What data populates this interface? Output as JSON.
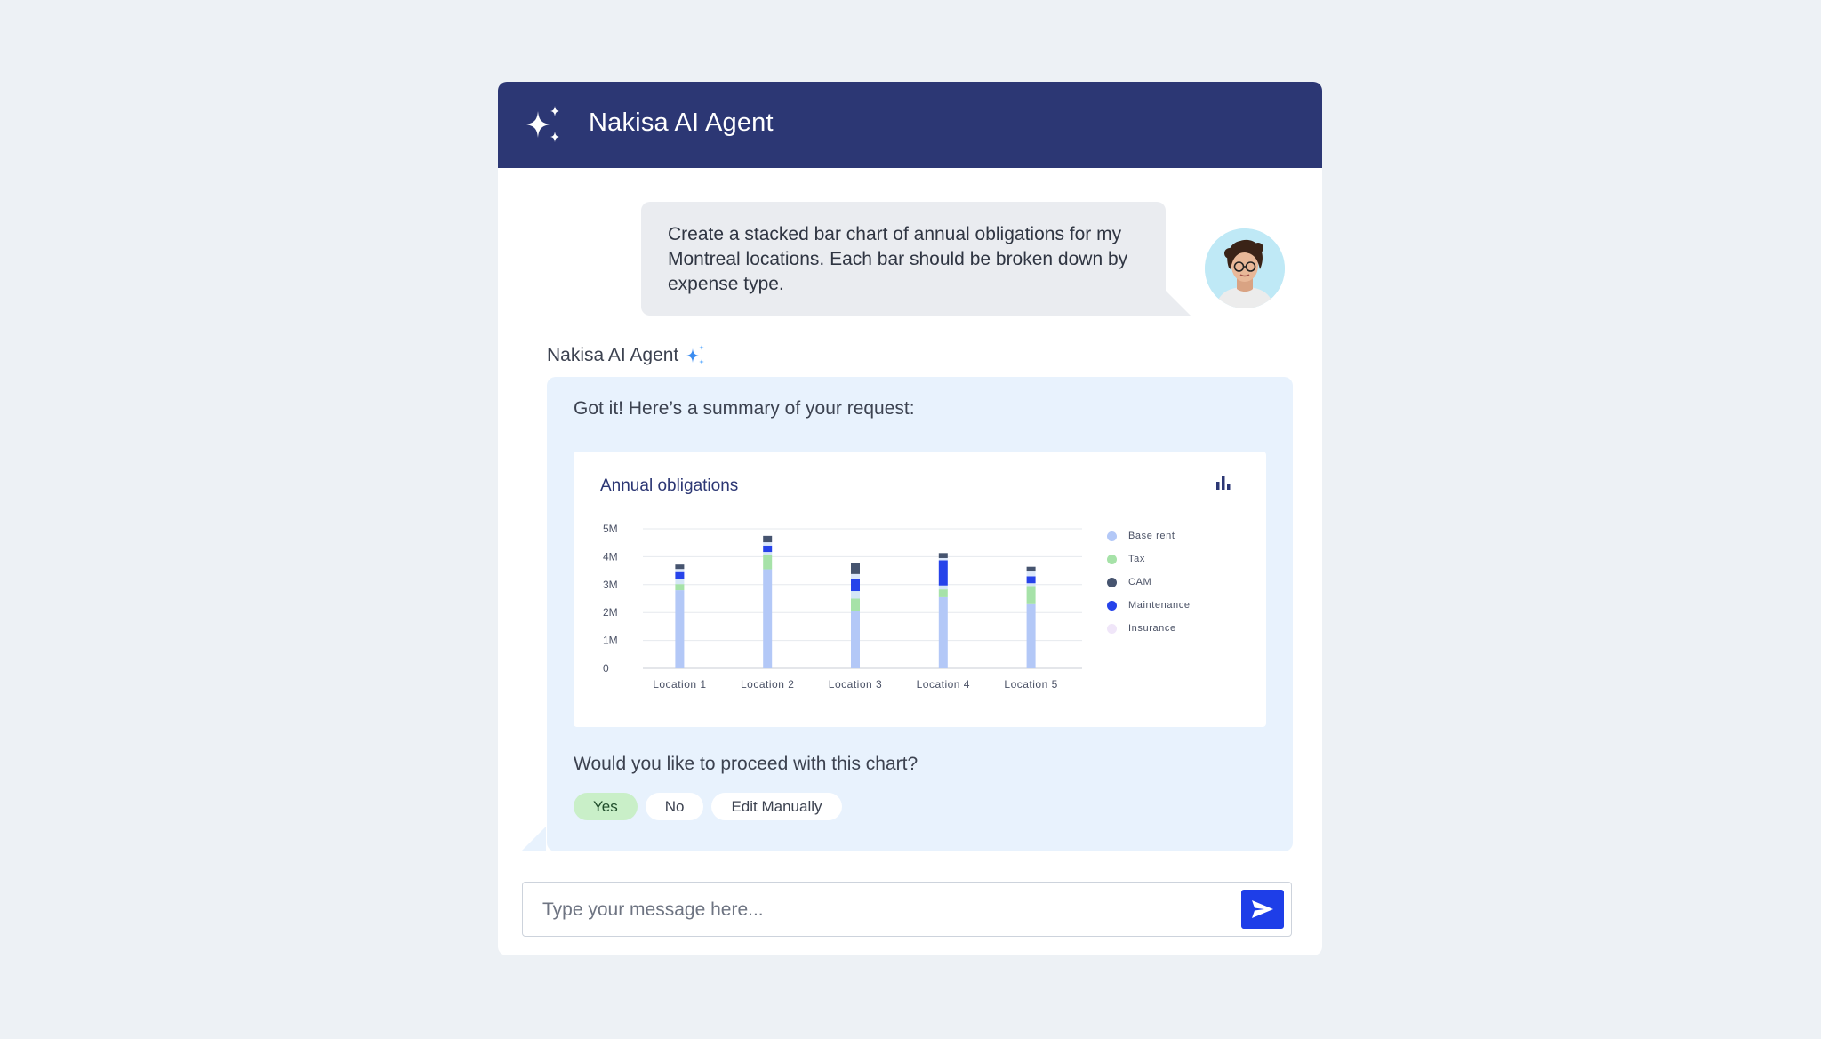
{
  "header": {
    "title": "Nakisa AI Agent"
  },
  "user_message": {
    "text": "Create a stacked bar chart of annual obligations for my Montreal locations. Each bar should be broken down by expense type."
  },
  "agent": {
    "label": "Nakisa AI Agent",
    "summary": "Got it! Here’s a summary of your request:",
    "question": "Would you like to proceed with this chart?",
    "choices": [
      "Yes",
      "No",
      "Edit Manually"
    ]
  },
  "input": {
    "placeholder": "Type your message here..."
  },
  "colors": {
    "header_bg": "#2c3774",
    "send_button": "#1e3ee8",
    "yes_chip": "#c9efc8"
  },
  "chart_data": {
    "type": "bar",
    "stacked": true,
    "title": "Annual obligations",
    "categories": [
      "Location 1",
      "Location 2",
      "Location 3",
      "Location 4",
      "Location 5"
    ],
    "ylim": [
      0,
      5000000
    ],
    "yticks": [
      {
        "value": 0,
        "label": "0"
      },
      {
        "value": 1000000,
        "label": "1M"
      },
      {
        "value": 2000000,
        "label": "2M"
      },
      {
        "value": 3000000,
        "label": "3M"
      },
      {
        "value": 4000000,
        "label": "4M"
      },
      {
        "value": 5000000,
        "label": "5M"
      }
    ],
    "grid": true,
    "legend_position": "right",
    "series": [
      {
        "name": "Base rent",
        "color": "#b3c8f7",
        "values": [
          2800000,
          3550000,
          2050000,
          2550000,
          2300000
        ]
      },
      {
        "name": "Tax",
        "color": "#a6e2a8",
        "values": [
          220000,
          500000,
          450000,
          280000,
          650000
        ]
      },
      {
        "name": "CAM",
        "color": "#d4e6f6",
        "values": [
          170000,
          120000,
          270000,
          140000,
          100000
        ]
      },
      {
        "name": "Maintenance",
        "color": "#2643ea",
        "values": [
          260000,
          230000,
          430000,
          900000,
          250000
        ]
      },
      {
        "name": "Insurance",
        "color": "#dce8fb",
        "values": [
          110000,
          120000,
          180000,
          80000,
          170000
        ]
      },
      {
        "name": "",
        "color": "#46546f",
        "values": [
          160000,
          230000,
          380000,
          180000,
          170000
        ]
      }
    ],
    "legend": [
      {
        "name": "Base rent",
        "color": "#b3c8f7"
      },
      {
        "name": "Tax",
        "color": "#a6e2a8"
      },
      {
        "name": "CAM",
        "color": "#46546f"
      },
      {
        "name": "Maintenance",
        "color": "#2643ea"
      },
      {
        "name": "Insurance",
        "color": "#f0e6f9"
      }
    ]
  }
}
